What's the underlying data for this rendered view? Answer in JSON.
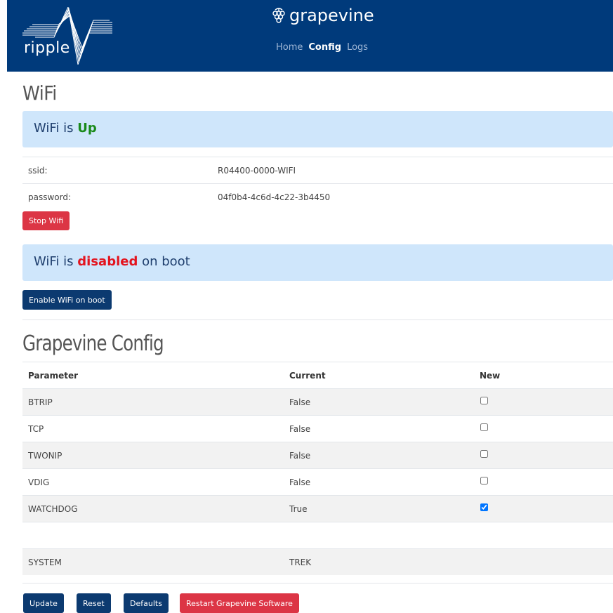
{
  "header": {
    "logo_text": "ripple",
    "brand": "grapevine",
    "nav": [
      {
        "label": "Home"
      },
      {
        "label": "Config"
      },
      {
        "label": "Logs"
      }
    ]
  },
  "wifi": {
    "title": "WiFi",
    "status_prefix": "WiFi is ",
    "status_value": "Up",
    "fields": [
      {
        "label": "ssid:",
        "value": "R04400-0000-WIFI"
      },
      {
        "label": "password:",
        "value": "04f0b4-4c6d-4c22-3b4450"
      }
    ],
    "stop_button": "Stop Wifi",
    "boot_prefix": "WiFi is ",
    "boot_value": "disabled",
    "boot_suffix": " on boot",
    "enable_button": "Enable WiFi on boot"
  },
  "config": {
    "title": "Grapevine Config",
    "columns": [
      "Parameter",
      "Current",
      "New"
    ],
    "rows": [
      {
        "param": "BTRIP",
        "current": "False",
        "checked": false
      },
      {
        "param": "TCP",
        "current": "False",
        "checked": false
      },
      {
        "param": "TWONIP",
        "current": "False",
        "checked": false
      },
      {
        "param": "VDIG",
        "current": "False",
        "checked": false
      },
      {
        "param": "WATCHDOG",
        "current": "True",
        "checked": true
      },
      {
        "param": "",
        "current": "",
        "checked": null
      },
      {
        "param": "SYSTEM",
        "current": "TREK",
        "checked": null
      }
    ],
    "buttons": {
      "update": "Update",
      "reset": "Reset",
      "defaults": "Defaults",
      "restart": "Restart Grapevine Software"
    }
  },
  "colors": {
    "header_bg": "#003a7b",
    "alert_bg": "#cfe6fb",
    "status_up": "#1a8a1a",
    "status_disabled": "#e3141e",
    "btn_red": "#dc3545",
    "btn_blue": "#0c3a70"
  }
}
